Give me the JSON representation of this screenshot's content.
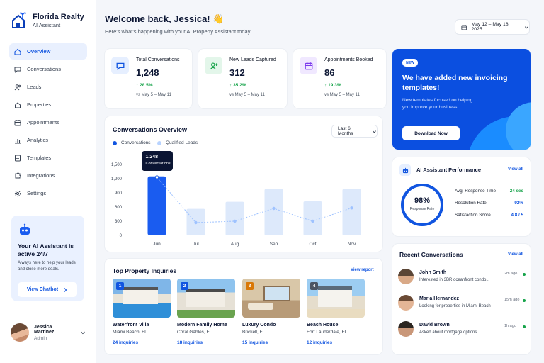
{
  "brand": {
    "name": "Florida Realty",
    "subtitle": "AI Assistant"
  },
  "sidebar": {
    "items": [
      {
        "label": "Overview",
        "icon": "home-icon",
        "active": true
      },
      {
        "label": "Conversations",
        "icon": "chat-icon"
      },
      {
        "label": "Leads",
        "icon": "users-icon"
      },
      {
        "label": "Properties",
        "icon": "house-icon"
      },
      {
        "label": "Appointments",
        "icon": "calendar-icon"
      },
      {
        "label": "Analytics",
        "icon": "bar-chart-icon"
      },
      {
        "label": "Templates",
        "icon": "template-icon"
      },
      {
        "label": "Integrations",
        "icon": "puzzle-icon"
      },
      {
        "label": "Settings",
        "icon": "gear-icon"
      }
    ],
    "promo": {
      "title": "Your AI Assistant is active 24/7",
      "description": "Always here to help your leads and close more deals.",
      "button": "View Chatbot"
    },
    "user": {
      "name": "Jessica Martinez",
      "role": "Admin"
    }
  },
  "header": {
    "greeting": "Welcome back, Jessica! 👋",
    "subtitle": "Here's what's happening with your AI Property Assistant today.",
    "date_range": "May 12 – May 18, 2025"
  },
  "stats": [
    {
      "label": "Total Conversations",
      "value": "1,248",
      "change": "28.5%",
      "compare": "vs May 5 – May 11",
      "icon": "chat-icon",
      "color": "#1155e0",
      "bg": "#e6efff"
    },
    {
      "label": "New Leads Captured",
      "value": "312",
      "change": "35.2%",
      "compare": "vs May 5 – May 11",
      "icon": "user-plus-icon",
      "color": "#16a34a",
      "bg": "#e3f6ea"
    },
    {
      "label": "Appointments Booked",
      "value": "86",
      "change": "19.3%",
      "compare": "vs May 5 – May 11",
      "icon": "calendar-icon",
      "color": "#7c3aed",
      "bg": "#f0e8ff"
    }
  ],
  "banner": {
    "badge": "NEW",
    "title": "We have added new invoicing templates!",
    "description": "New templates focused on helping you improve your business",
    "button": "Download Now"
  },
  "chart": {
    "title": "Conversations Overview",
    "range": "Last 6 Months",
    "tooltip_value": "1,248",
    "tooltip_label": "Conversations"
  },
  "chart_data": {
    "type": "bar",
    "categories": [
      "Jun",
      "Jul",
      "Aug",
      "Sep",
      "Oct",
      "Nov"
    ],
    "series": [
      {
        "name": "Conversations",
        "type": "bar",
        "color": "#1a5cf0",
        "values": [
          1248,
          0,
          0,
          0,
          0,
          0
        ]
      },
      {
        "name": "Qualified Leads",
        "type": "line",
        "color": "#9ec2ff",
        "values": [
          1230,
          270,
          300,
          570,
          300,
          580
        ]
      }
    ],
    "background_bars": [
      1248,
      560,
      710,
      980,
      720,
      980
    ],
    "yticks": [
      "0",
      "300",
      "600",
      "900",
      "1,200",
      "1,500"
    ],
    "ylim": [
      0,
      1500
    ],
    "grid": false,
    "legend": "top-left"
  },
  "properties": {
    "title": "Top Property Inquiries",
    "view_all": "View report",
    "items": [
      {
        "num": "1",
        "name": "Waterfront Villa",
        "location": "Miami Beach, FL",
        "inquiries": "24 inquiries"
      },
      {
        "num": "2",
        "name": "Modern Family Home",
        "location": "Coral Gables, FL",
        "inquiries": "18 inquiries"
      },
      {
        "num": "3",
        "name": "Luxury Condo",
        "location": "Brickell, FL",
        "inquiries": "15 inquiries"
      },
      {
        "num": "4",
        "name": "Beach House",
        "location": "Fort Lauderdale, FL",
        "inquiries": "12 inquiries"
      }
    ]
  },
  "performance": {
    "title": "AI Assistant Performance",
    "view_all": "View all",
    "rate": "98%",
    "rate_label": "Response Rate",
    "rate_fraction": 0.98,
    "metrics": [
      {
        "label": "Avg. Response Time",
        "value": "24 sec",
        "color": "#16a34a"
      },
      {
        "label": "Resolution Rate",
        "value": "92%",
        "color": "#1155e0"
      },
      {
        "label": "Satisfaction Score",
        "value": "4.8 / 5",
        "color": "#1155e0"
      }
    ]
  },
  "recent": {
    "title": "Recent Conversations",
    "view_all": "View all",
    "items": [
      {
        "name": "John Smith",
        "message": "Interested in 3BR oceanfront condo...",
        "time": "2m ago"
      },
      {
        "name": "Maria Hernandez",
        "message": "Looking for properties in Miami Beach",
        "time": "15m ago"
      },
      {
        "name": "David Brown",
        "message": "Asked about mortgage options",
        "time": "1h ago"
      }
    ]
  }
}
